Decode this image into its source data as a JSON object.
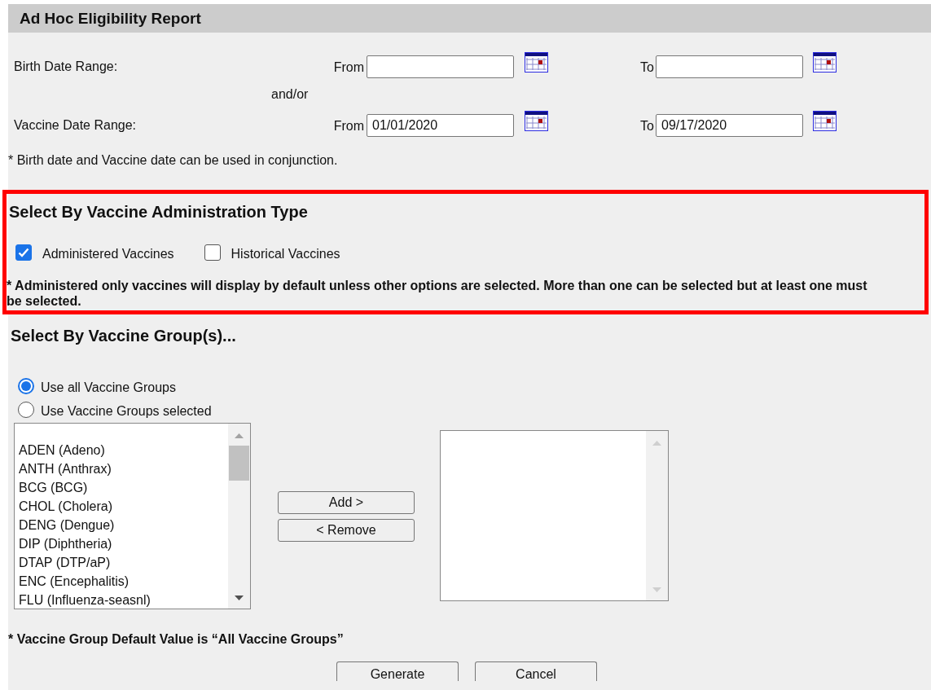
{
  "title": "Ad Hoc Eligibility Report",
  "date_ranges": [
    {
      "label": "Birth Date Range:",
      "from": {
        "label": "From"
      },
      "to": {
        "label": "To"
      }
    },
    {
      "label": "Vaccine Date Range:",
      "from": {
        "label": "From",
        "value": "01/01/2020"
      },
      "to": {
        "label": "To",
        "value": "09/17/2020"
      }
    }
  ],
  "separator": "and/or",
  "date_note": "* Birth date and Vaccine date can be used in conjunction.",
  "administration_type": {
    "title": "Select By Vaccine Administration Type",
    "highlighted": true,
    "options": [
      {
        "label": "Administered Vaccines",
        "checked": true
      },
      {
        "label": "Historical Vaccines",
        "checked": false
      }
    ],
    "note": "* Administered only vaccines will display by default unless other options are selected. More than one can be selected but at least one must be selected."
  },
  "vaccine_groups": {
    "title": "Select By Vaccine Group(s)...",
    "radios": [
      {
        "label": "Use all Vaccine Groups",
        "selected": true
      },
      {
        "label": "Use Vaccine Groups selected",
        "selected": false
      }
    ],
    "available": [
      "ADEN (Adeno)",
      "ANTH (Anthrax)",
      "BCG (BCG)",
      "CHOL (Cholera)",
      "DENG (Dengue)",
      "DIP (Diphtheria)",
      "DTAP (DTP/aP)",
      "ENC (Encephalitis)",
      "FLU (Influenza-seasnl)"
    ],
    "move_buttons": [
      "Add >",
      "< Remove"
    ],
    "note": "* Vaccine Group Default Value is “All Vaccine Groups”"
  },
  "buttons": [
    "Generate",
    "Cancel"
  ]
}
